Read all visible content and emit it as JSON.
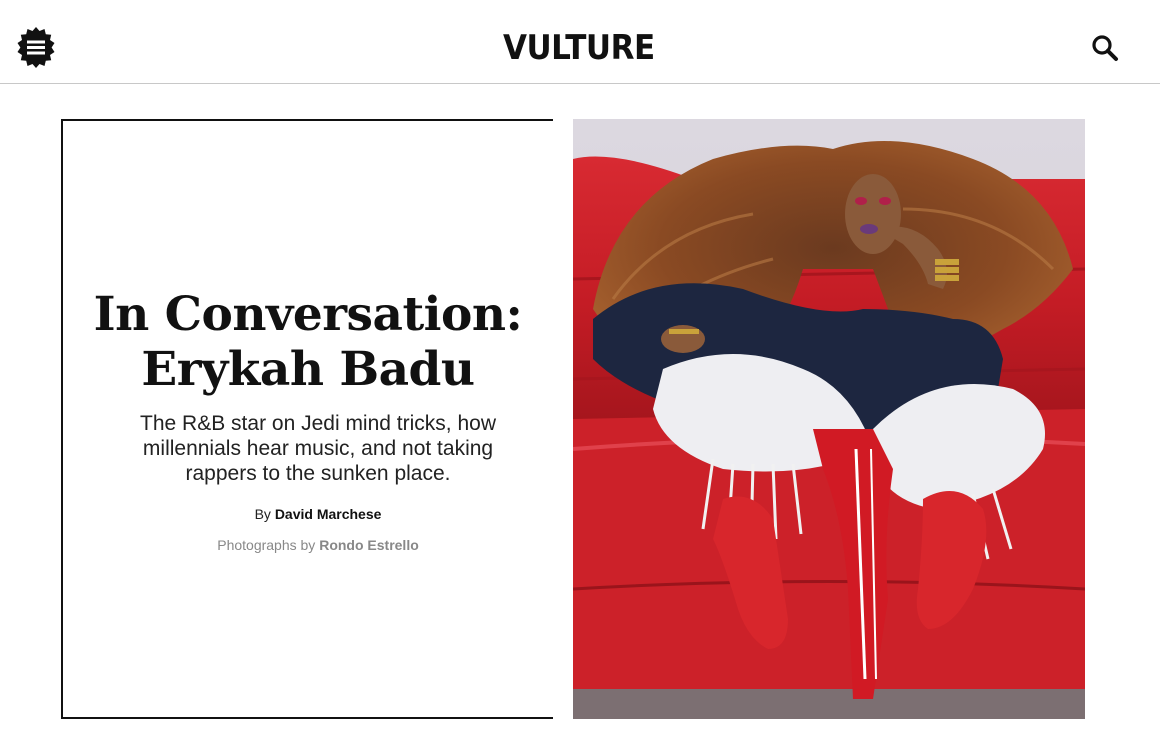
{
  "header": {
    "menu_icon": "hamburger-badge-icon",
    "logo_text": "VULTURE",
    "search_icon": "search-icon"
  },
  "article": {
    "headline_line1": "In Conversation:",
    "headline_line2": "Erykah Badu",
    "dek": "The R&B star on Jedi mind tricks, how millennials hear music, and not taking rappers to the sunken place.",
    "byline_prefix": "By",
    "author": "David Marchese",
    "credit_prefix": "Photographs by",
    "photographer": "Rondo Estrello"
  },
  "colors": {
    "text": "#111111",
    "muted": "#888888",
    "divider": "#c8c8c8",
    "sofa_red": "#c81e26"
  }
}
